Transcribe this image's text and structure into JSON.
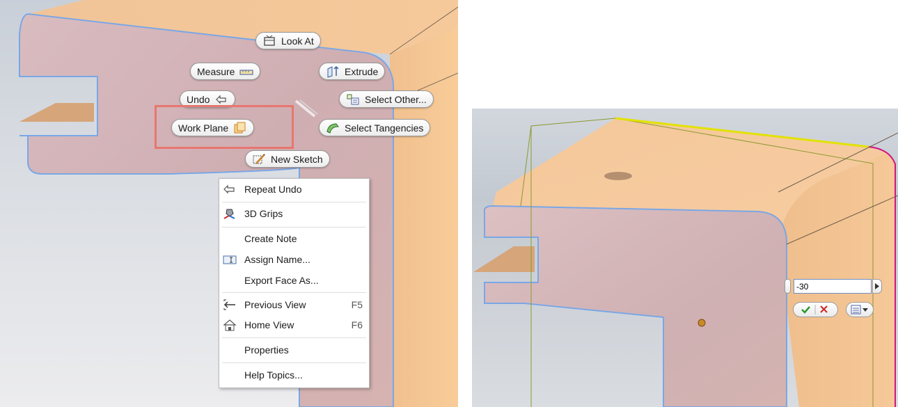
{
  "left_panel": {
    "marking_menu": {
      "look_at": "Look At",
      "measure": "Measure",
      "extrude": "Extrude",
      "undo": "Undo",
      "select_other": "Select Other...",
      "work_plane": "Work Plane",
      "select_tangencies": "Select Tangencies",
      "new_sketch": "New Sketch"
    },
    "highlight_color": "#e8766f",
    "context_menu": {
      "items": [
        {
          "label": "Repeat Undo",
          "icon": "repeat-undo-icon"
        },
        {
          "label": "3D Grips",
          "icon": "3d-grips-icon"
        },
        {
          "label": "Create Note"
        },
        {
          "label": "Assign Name...",
          "icon": "assign-name-icon"
        },
        {
          "label": "Export Face As..."
        },
        {
          "label": "Previous View",
          "shortcut": "F5",
          "icon": "previous-view-icon"
        },
        {
          "label": "Home View",
          "shortcut": "F6",
          "icon": "home-view-icon"
        },
        {
          "label": "Properties"
        },
        {
          "label": "Help Topics..."
        }
      ]
    }
  },
  "right_panel": {
    "dimension_input": {
      "value": "-30"
    },
    "work_plane_color": "#8a9a2e",
    "highlight_edge_color": "#e2e200",
    "highlight_curve_color": "#d4127f"
  },
  "colors": {
    "face_top": "#f3c394",
    "face_front": "#d7b3b5",
    "edge_outline": "#7aa7e6"
  }
}
